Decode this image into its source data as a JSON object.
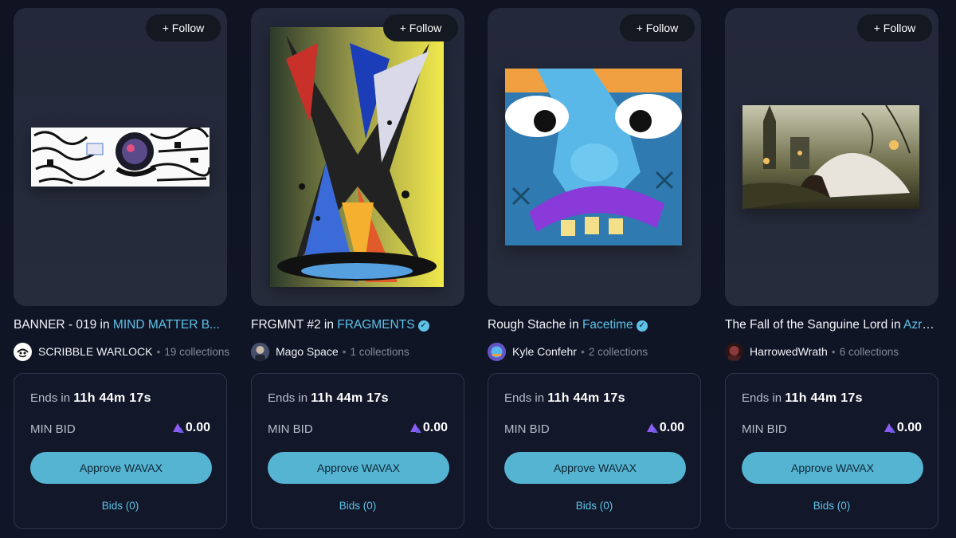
{
  "cards": [
    {
      "follow_label": "+ Follow",
      "title": "BANNER - 019",
      "in_word": " in ",
      "collection": "MIND MATTER B...",
      "verified": false,
      "creator": "SCRIBBLE WARLOCK",
      "collections_count": "19 collections",
      "ends_label": "Ends in",
      "countdown": "11h 44m 17s",
      "min_bid_label": "MIN BID",
      "min_bid_value": "0.00",
      "approve_label": "Approve WAVAX",
      "bids_label": "Bids (0)"
    },
    {
      "follow_label": "+ Follow",
      "title": "FRGMNT #2",
      "in_word": " in ",
      "collection": "FRAGMENTS",
      "verified": true,
      "creator": "Mago Space",
      "collections_count": "1 collections",
      "ends_label": "Ends in",
      "countdown": "11h 44m 17s",
      "min_bid_label": "MIN BID",
      "min_bid_value": "0.00",
      "approve_label": "Approve WAVAX",
      "bids_label": "Bids (0)"
    },
    {
      "follow_label": "+ Follow",
      "title": "Rough Stache",
      "in_word": " in ",
      "collection": "Facetime",
      "verified": true,
      "creator": "Kyle Confehr",
      "collections_count": "2 collections",
      "ends_label": "Ends in",
      "countdown": "11h 44m 17s",
      "min_bid_label": "MIN BID",
      "min_bid_value": "0.00",
      "approve_label": "Approve WAVAX",
      "bids_label": "Bids (0)"
    },
    {
      "follow_label": "+ Follow",
      "title": "The Fall of the Sanguine Lord",
      "in_word": " in ",
      "collection": "Azra...",
      "verified": false,
      "creator": "HarrowedWrath",
      "collections_count": "6 collections",
      "ends_label": "Ends in",
      "countdown": "11h 44m 17s",
      "min_bid_label": "MIN BID",
      "min_bid_value": "0.00",
      "approve_label": "Approve WAVAX",
      "bids_label": "Bids (0)"
    }
  ],
  "separator": "•",
  "verified_glyph": "✓",
  "colors": {
    "accent": "#5ec2e6",
    "button": "#56b4d3",
    "background": "#0f1322",
    "card": "#252a3b",
    "avax": "#8b5cf6"
  },
  "icons": {
    "verified": "verified-badge-icon",
    "currency": "avax-logo-icon"
  }
}
